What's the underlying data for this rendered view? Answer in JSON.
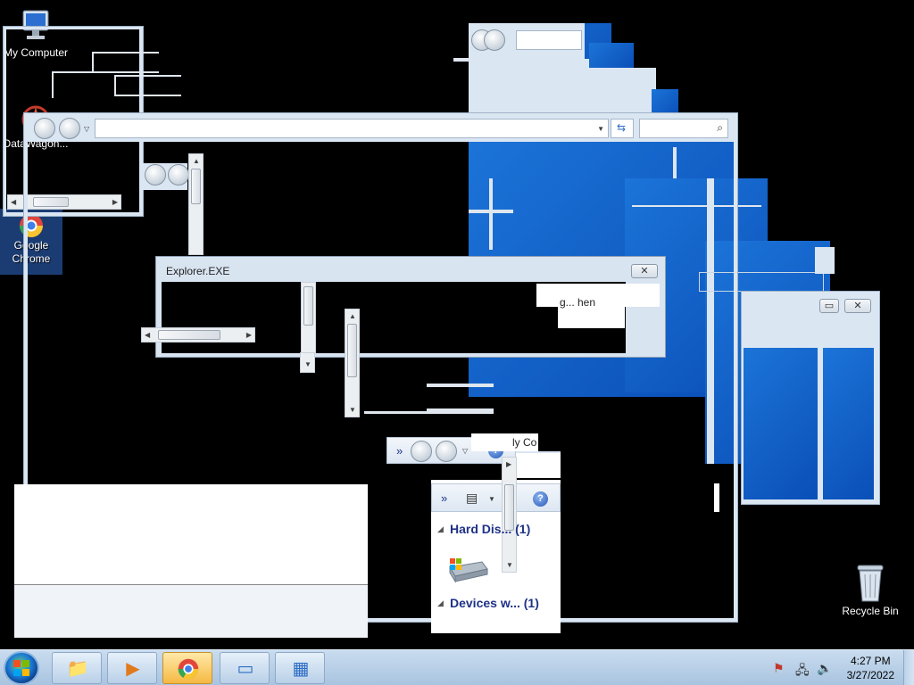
{
  "desktop": {
    "icons": [
      {
        "label": "My Computer",
        "icon": "computer-icon"
      },
      {
        "label": "DataWagon...",
        "icon": "datawagon-icon"
      },
      {
        "label": "Google Chrome",
        "icon": "chrome-icon"
      },
      {
        "label": "Recycle Bin",
        "icon": "recycle-bin-icon"
      }
    ]
  },
  "explorer_exe": {
    "title": "Explorer.EXE",
    "close_glyph": "✕",
    "fragment_text": "g... hen"
  },
  "control_panel": {
    "chevron": "»",
    "help": "?",
    "fragment_title": "ly Co",
    "groups": [
      {
        "label": "Hard Dis...",
        "count": "(1)"
      },
      {
        "label": "Devices w...",
        "count": "(1)"
      }
    ]
  },
  "taskbar": {
    "buttons": [
      {
        "name": "start-button",
        "glyph": "⊞"
      },
      {
        "name": "explorer",
        "glyph": "📁"
      },
      {
        "name": "media-player",
        "glyph": "▶"
      },
      {
        "name": "chrome",
        "glyph": "◉"
      },
      {
        "name": "app",
        "glyph": "▭"
      },
      {
        "name": "control-panel",
        "glyph": "▦"
      }
    ],
    "clock": {
      "time": "4:27 PM",
      "date": "3/27/2022"
    }
  },
  "colors": {
    "desktop_bg": "#000000",
    "window_accent": "#1c74d8",
    "taskbar": "#c9dcef"
  }
}
